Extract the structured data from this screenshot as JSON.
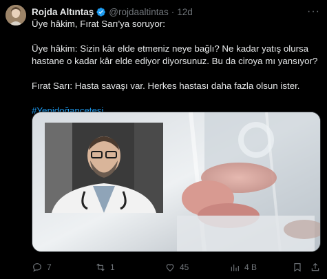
{
  "author": {
    "name": "Rojda Altıntaş",
    "handle": "@rojdaaltintas",
    "separator": "·",
    "time": "12d",
    "more": "···"
  },
  "tweet": {
    "line1": "Üye hâkim, Fırat Sarı'ya soruyor:",
    "para2": "Üye hâkim: Sizin kâr elde etmeniz neye bağlı? Ne kadar yatış olursa hastane o kadar kâr elde ediyor diyorsunuz. Bu da ciroya mı yansıyor?",
    "para3": "Fırat Sarı: Hasta savaşı var. Herkes hastası daha fazla olsun ister.",
    "hashtag": "#Yenidoğançetesi"
  },
  "metrics": {
    "replies": "7",
    "reposts": "1",
    "likes": "45",
    "views": "4 B"
  },
  "colors": {
    "background": "#000000",
    "text": "#e7e9ea",
    "muted": "#71767b",
    "accent": "#1d9bf0"
  },
  "icons": {
    "verified": "verified-badge-icon",
    "reply": "reply-icon",
    "repost": "repost-icon",
    "like": "heart-icon",
    "views": "views-chart-icon",
    "more": "more-options-icon"
  }
}
